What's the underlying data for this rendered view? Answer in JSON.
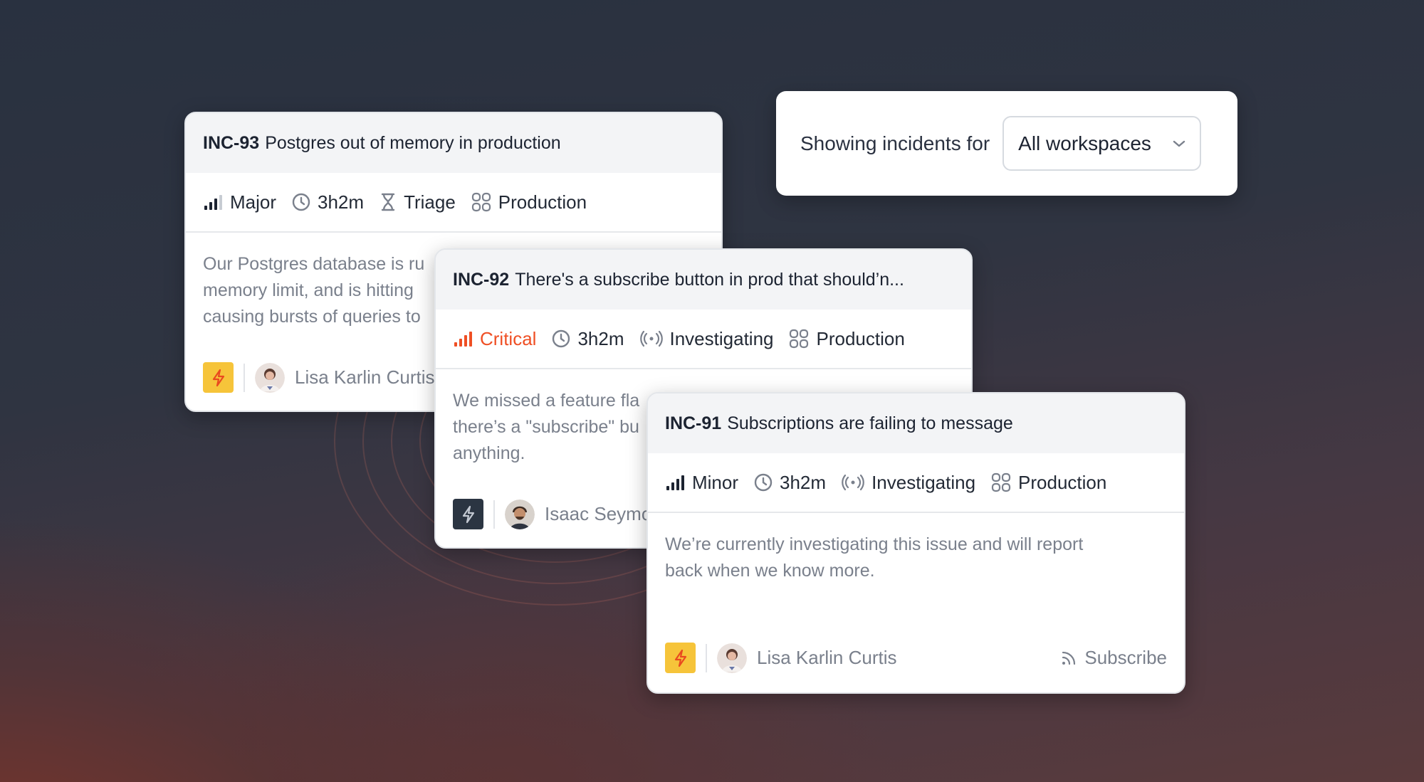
{
  "filter": {
    "label": "Showing incidents for",
    "selected": "All workspaces"
  },
  "incidents": [
    {
      "id": "INC-93",
      "title": "Postgres out of memory in production",
      "severity": "Major",
      "severity_level": "major",
      "duration": "3h2m",
      "status": "Triage",
      "status_icon": "hourglass-icon",
      "environment": "Production",
      "description": "Our Postgres database is ru\nmemory limit, and is hitting\ncausing bursts of queries to",
      "lead_icon_style": "yellow",
      "assignee": "Lisa Karlin Curtis"
    },
    {
      "id": "INC-92",
      "title": "There's a subscribe button in prod that should’n...",
      "severity": "Critical",
      "severity_level": "critical",
      "duration": "3h2m",
      "status": "Investigating",
      "status_icon": "broadcast-icon",
      "environment": "Production",
      "description": "We missed a feature fla\nthere’s a \"subscribe\" bu\nanything.",
      "lead_icon_style": "dark",
      "assignee": "Isaac Seymo"
    },
    {
      "id": "INC-91",
      "title": "Subscriptions are failing to message",
      "severity": "Minor",
      "severity_level": "minor",
      "duration": "3h2m",
      "status": "Investigating",
      "status_icon": "broadcast-icon",
      "environment": "Production",
      "description": "We’re currently investigating this issue and will report\nback when we know more.",
      "lead_icon_style": "yellow",
      "assignee": "Lisa Karlin Curtis",
      "subscribe_label": "Subscribe"
    }
  ],
  "colors": {
    "critical": "#ef4f24",
    "bolt_yellow": "#f6c43a",
    "bolt_dark": "#2b3542"
  }
}
